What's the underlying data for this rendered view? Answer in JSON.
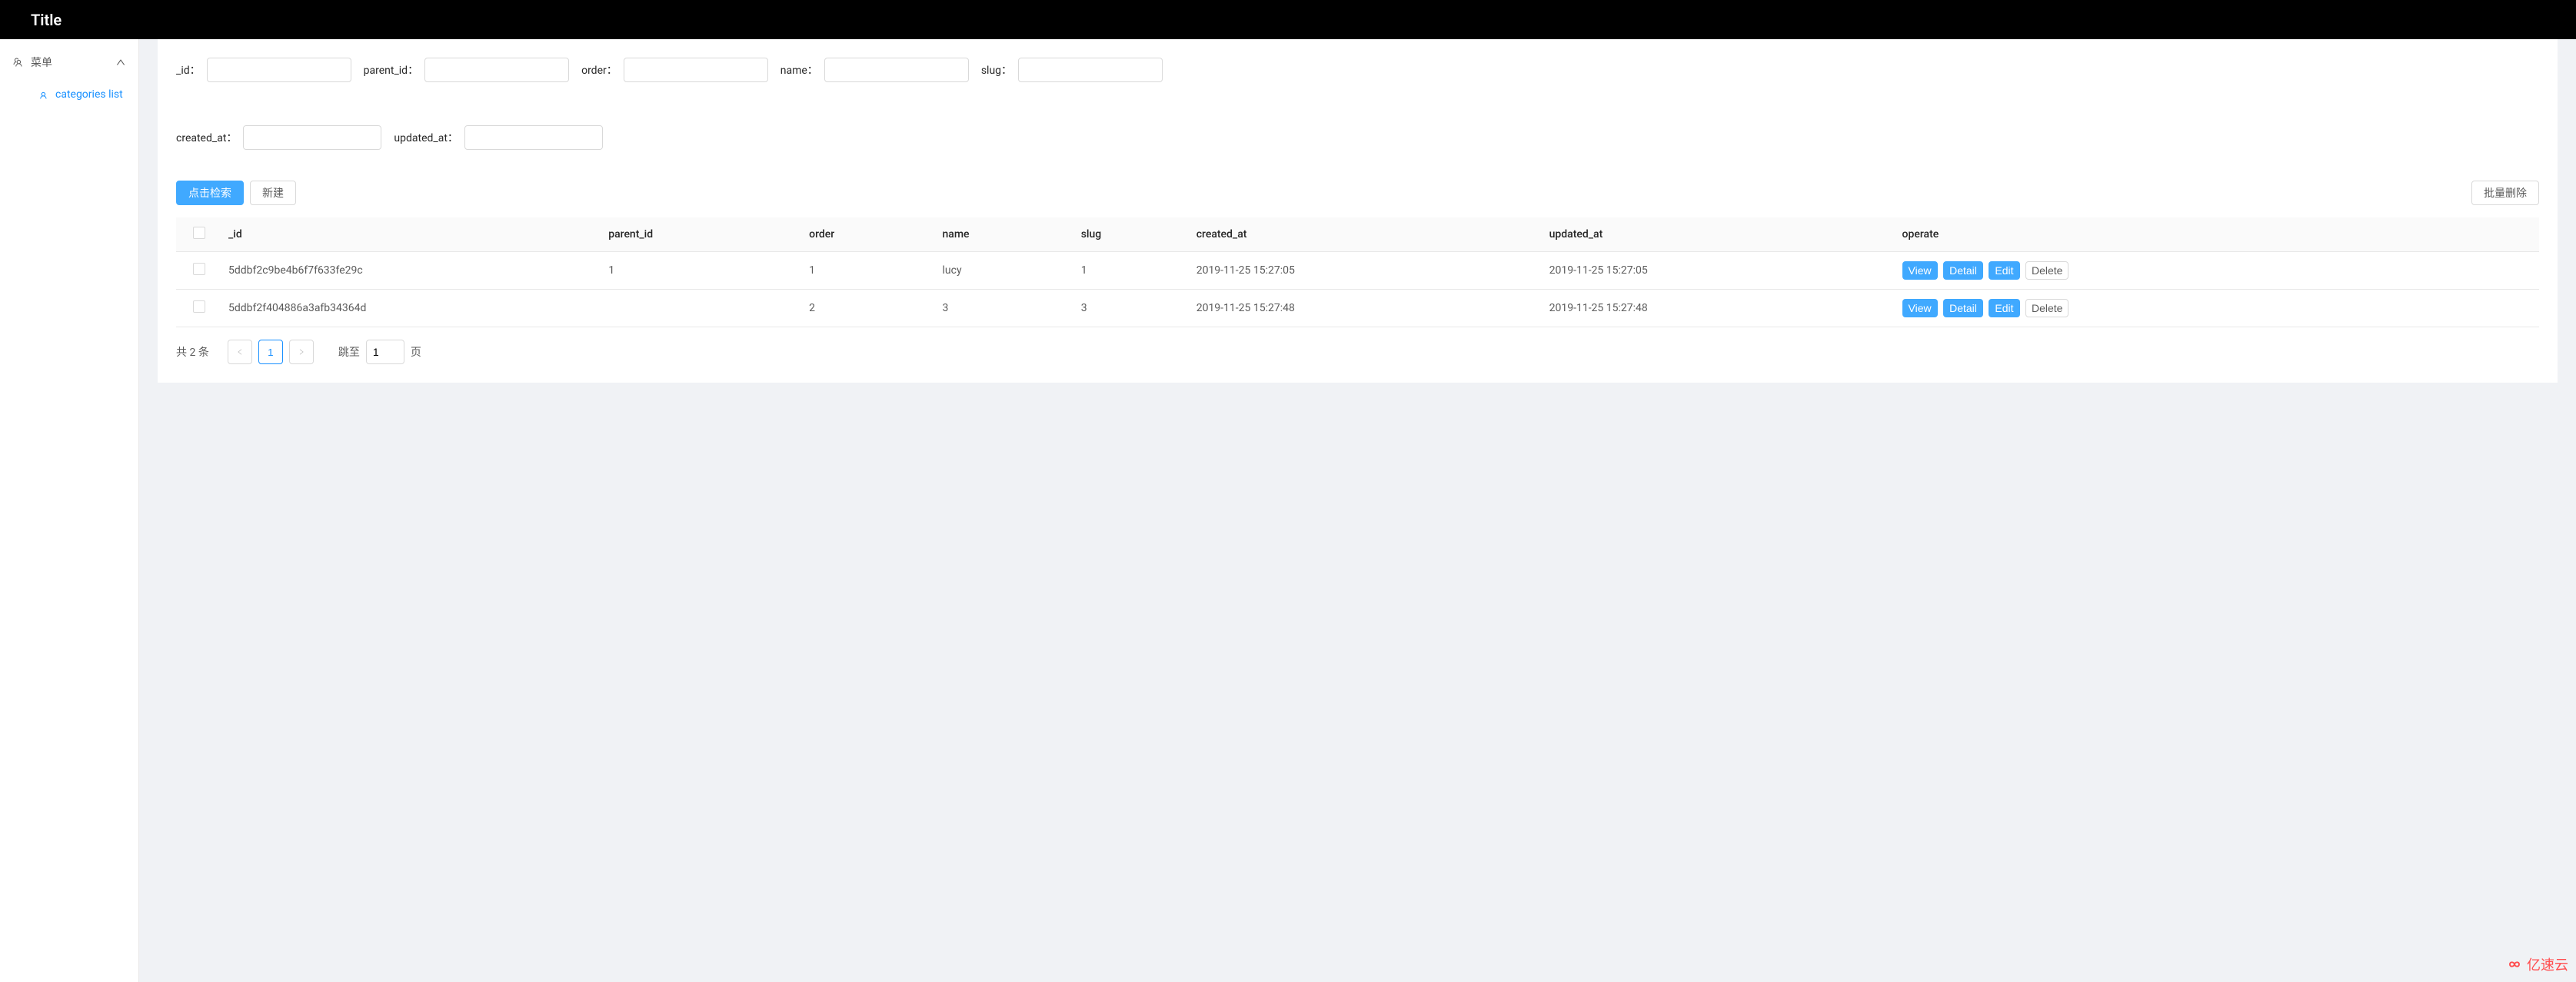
{
  "header": {
    "title": "Title"
  },
  "sidebar": {
    "menu_label": "菜单",
    "sub_items": [
      {
        "label": "categories list"
      }
    ]
  },
  "search_form": {
    "fields": [
      {
        "label": "_id："
      },
      {
        "label": "parent_id："
      },
      {
        "label": "order："
      },
      {
        "label": "name："
      },
      {
        "label": "slug："
      },
      {
        "label": "created_at："
      },
      {
        "label": "updated_at："
      }
    ]
  },
  "buttons": {
    "search": "点击检索",
    "create": "新建",
    "batch_delete": "批量删除",
    "view": "View",
    "detail": "Detail",
    "edit": "Edit",
    "delete": "Delete"
  },
  "table": {
    "headers": {
      "id": "_id",
      "parent_id": "parent_id",
      "order": "order",
      "name": "name",
      "slug": "slug",
      "created_at": "created_at",
      "updated_at": "updated_at",
      "operate": "operate"
    },
    "rows": [
      {
        "id": "5ddbf2c9be4b6f7f633fe29c",
        "parent_id": "1",
        "order": "1",
        "name": "lucy",
        "slug": "1",
        "created_at": "2019-11-25 15:27:05",
        "updated_at": "2019-11-25 15:27:05"
      },
      {
        "id": "5ddbf2f404886a3afb34364d",
        "parent_id": "",
        "order": "2",
        "name": "3",
        "slug": "3",
        "created_at": "2019-11-25 15:27:48",
        "updated_at": "2019-11-25 15:27:48"
      }
    ]
  },
  "pagination": {
    "total_text": "共 2 条",
    "current_page": "1",
    "jump_label": "跳至",
    "jump_value": "1",
    "page_suffix": "页"
  },
  "watermark": {
    "text": "亿速云"
  }
}
